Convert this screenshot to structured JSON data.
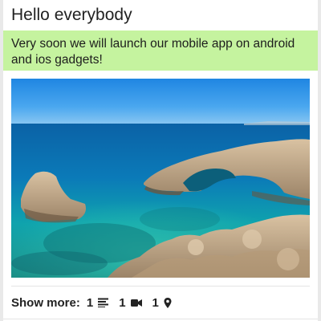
{
  "post": {
    "title": "Hello everybody",
    "banner": "Very soon we will launch our mobile app on android and ios gadgets!",
    "banner_color": "#c5f39f"
  },
  "footer": {
    "show_more_label": "Show more:",
    "stats": [
      {
        "count": "1",
        "icon": "text-lines-icon"
      },
      {
        "count": "1",
        "icon": "video-camera-icon"
      },
      {
        "count": "1",
        "icon": "map-pin-icon"
      }
    ]
  }
}
